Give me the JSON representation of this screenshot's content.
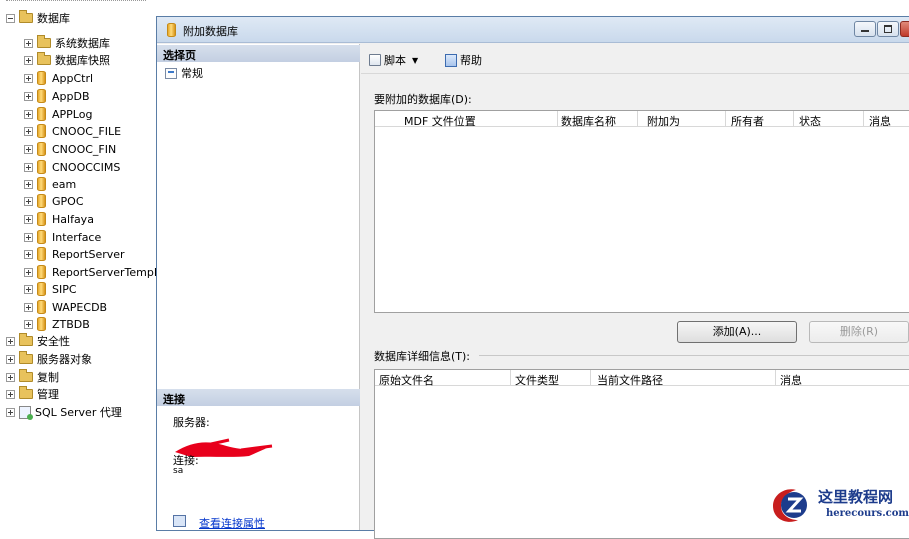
{
  "tree": {
    "databases": "数据库",
    "system_databases": "系统数据库",
    "db_snapshots": "数据库快照",
    "dbs": [
      "AppCtrl",
      "AppDB",
      "APPLog",
      "CNOOC_FILE",
      "CNOOC_FIN",
      "CNOOCCIMS",
      "eam",
      "GPOC",
      "Halfaya",
      "Interface",
      "ReportServer",
      "ReportServerTempD",
      "SIPC",
      "WAPECDB",
      "ZTBDB"
    ],
    "security": "安全性",
    "server_objects": "服务器对象",
    "replication": "复制",
    "management": "管理",
    "agent": "SQL Server 代理"
  },
  "dialog": {
    "title": "附加数据库",
    "select_page": "选择页",
    "page_general": "常规",
    "connection": "连接",
    "server_label": "服务器:",
    "connection_label": "连接:",
    "connection_value": "sa",
    "view_props_link": "查看连接属性",
    "toolbar": {
      "script": "脚本",
      "help": "帮助"
    },
    "attach_label": "要附加的数据库(D):",
    "attach_columns": [
      "MDF 文件位置",
      "数据库名称",
      "附加为",
      "所有者",
      "状态",
      "消息"
    ],
    "add_button": "添加(A)...",
    "remove_button": "删除(R)",
    "details_label": "数据库详细信息(T):",
    "details_columns": [
      "原始文件名",
      "文件类型",
      "当前文件路径",
      "消息"
    ]
  },
  "watermark": {
    "name": "这里教程网",
    "url": "herecours.com"
  },
  "colors": {
    "accent": "#1d3c8c",
    "link": "#0033cc",
    "scribble": "#e8001c"
  }
}
